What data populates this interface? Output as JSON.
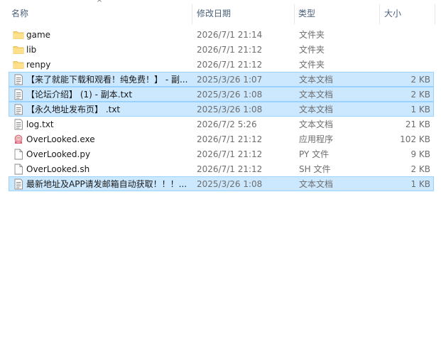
{
  "columns": {
    "name": "名称",
    "date": "修改日期",
    "type": "类型",
    "size": "大小"
  },
  "sort_indicator": "^",
  "files": [
    {
      "name": "game",
      "date": "2026/7/1 21:14",
      "type": "文件夹",
      "size": "",
      "icon": "folder-icon",
      "selected": false
    },
    {
      "name": "lib",
      "date": "2026/7/1 21:12",
      "type": "文件夹",
      "size": "",
      "icon": "folder-icon",
      "selected": false
    },
    {
      "name": "renpy",
      "date": "2026/7/1 21:12",
      "type": "文件夹",
      "size": "",
      "icon": "folder-icon",
      "selected": false
    },
    {
      "name": "【来了就能下载和观看！纯免费！】 - 副...",
      "date": "2025/3/26 1:07",
      "type": "文本文档",
      "size": "2 KB",
      "icon": "text-document-icon",
      "selected": true
    },
    {
      "name": "【论坛介绍】 (1) - 副本.txt",
      "date": "2025/3/26 1:08",
      "type": "文本文档",
      "size": "2 KB",
      "icon": "text-document-icon",
      "selected": true
    },
    {
      "name": "【永久地址发布页】 .txt",
      "date": "2025/3/26 1:08",
      "type": "文本文档",
      "size": "1 KB",
      "icon": "text-document-icon",
      "selected": true
    },
    {
      "name": "log.txt",
      "date": "2026/7/2 5:26",
      "type": "文本文档",
      "size": "21 KB",
      "icon": "text-document-icon",
      "selected": false
    },
    {
      "name": "OverLooked.exe",
      "date": "2026/7/1 21:12",
      "type": "应用程序",
      "size": "102 KB",
      "icon": "app-icon",
      "selected": false
    },
    {
      "name": "OverLooked.py",
      "date": "2026/7/1 21:12",
      "type": "PY 文件",
      "size": "9 KB",
      "icon": "blank-file-icon",
      "selected": false
    },
    {
      "name": "OverLooked.sh",
      "date": "2026/7/1 21:12",
      "type": "SH 文件",
      "size": "2 KB",
      "icon": "blank-file-icon",
      "selected": false
    },
    {
      "name": "最新地址及APP请发邮箱自动获取！！！...",
      "date": "2025/3/26 1:08",
      "type": "文本文档",
      "size": "1 KB",
      "icon": "text-document-icon",
      "selected": true
    }
  ],
  "colors": {
    "selection_bg": "#cce8ff",
    "selection_border": "#99d1ff",
    "folder": "#f8d775",
    "header_text": "#4c607a"
  }
}
